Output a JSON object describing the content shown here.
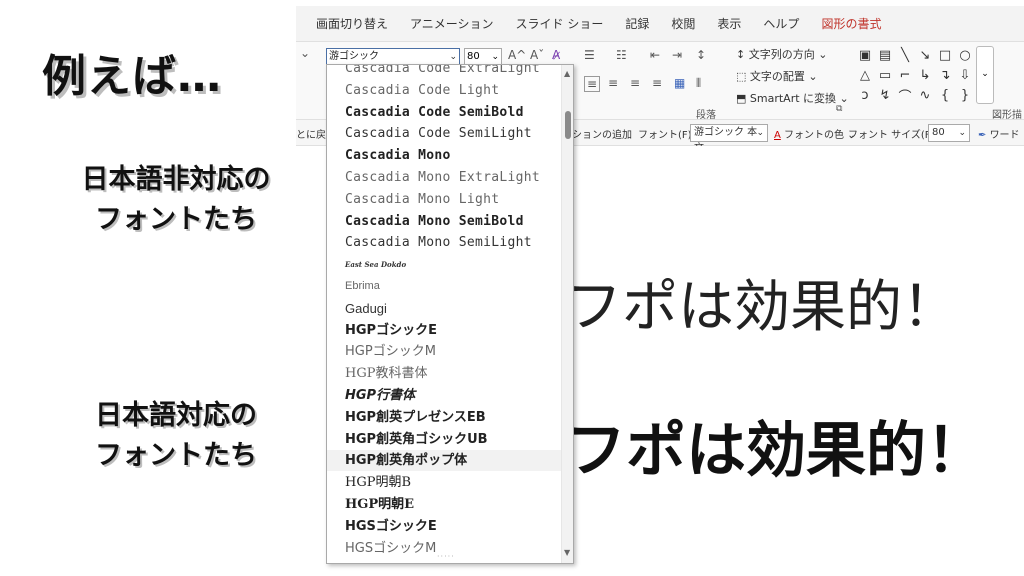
{
  "annotation": {
    "title": "例えば…",
    "group1_line1": "日本語非対応の",
    "group1_line2": "フォントたち",
    "group2_line1": "日本語対応の",
    "group2_line2": "フォントたち"
  },
  "ribbon": {
    "tabs": [
      "画面切り替え",
      "アニメーション",
      "スライド ショー",
      "記録",
      "校閲",
      "表示",
      "ヘルプ",
      "図形の書式"
    ],
    "active_tab": "図形の書式",
    "font_name": "游ゴシック",
    "font_size": "80",
    "grow_font": "A^",
    "shrink_font": "Aˇ",
    "text_direction": "文字列の方向",
    "align_text": "文字の配置",
    "smartart": "SmartArt に変換",
    "paragraph_group": "段落",
    "shape_styles_group": "図形描"
  },
  "mini_toolbar": {
    "reset": "とに戻",
    "add_animation": "ションの追加",
    "font_label": "フォント(F):",
    "font_value": "游ゴシック 本文",
    "font_color": "フォントの色",
    "size_label": "フォント サイズ(F):",
    "size_value": "80",
    "word": "ワード"
  },
  "font_list": {
    "items": [
      {
        "label": "Cascadia Code ExtraLight",
        "style": "mono light"
      },
      {
        "label": "Cascadia Code Light",
        "style": "mono light"
      },
      {
        "label": "Cascadia Code SemiBold",
        "style": "mono bold"
      },
      {
        "label": "Cascadia Code SemiLight",
        "style": "mono"
      },
      {
        "label": "Cascadia Mono",
        "style": "mono bold"
      },
      {
        "label": "Cascadia Mono ExtraLight",
        "style": "mono light"
      },
      {
        "label": "Cascadia Mono Light",
        "style": "mono light"
      },
      {
        "label": "Cascadia Mono SemiBold",
        "style": "mono bold"
      },
      {
        "label": "Cascadia Mono SemiLight",
        "style": "mono"
      },
      {
        "label": "East Sea Dokdo",
        "style": "deco"
      },
      {
        "label": "Ebrima",
        "style": "sans-small"
      },
      {
        "label": "Gadugi",
        "style": "sans"
      },
      {
        "label": "HGPゴシックE",
        "style": "jp bold"
      },
      {
        "label": "HGPゴシックM",
        "style": "jp light"
      },
      {
        "label": "HGP教科書体",
        "style": "jp light serif"
      },
      {
        "label": "HGP行書体",
        "style": "jp italic"
      },
      {
        "label": "HGP創英プレゼンスEB",
        "style": "jp bold"
      },
      {
        "label": "HGP創英角ゴシックUB",
        "style": "jp bold"
      },
      {
        "label": "HGP創英角ポップ体",
        "style": "jp bold"
      },
      {
        "label": "HGP明朝B",
        "style": "jp serif"
      },
      {
        "label": "HGP明朝E",
        "style": "jp bold serif"
      },
      {
        "label": "HGSゴシックE",
        "style": "jp bold"
      },
      {
        "label": "HGSゴシックM",
        "style": "jp light"
      }
    ],
    "hover_index": 18
  },
  "slide": {
    "text_light": "フポは効果的！",
    "text_bold": "フポは効果的！"
  },
  "colors": {
    "accent_red": "#e01818",
    "active_tab": "#c0342b"
  }
}
